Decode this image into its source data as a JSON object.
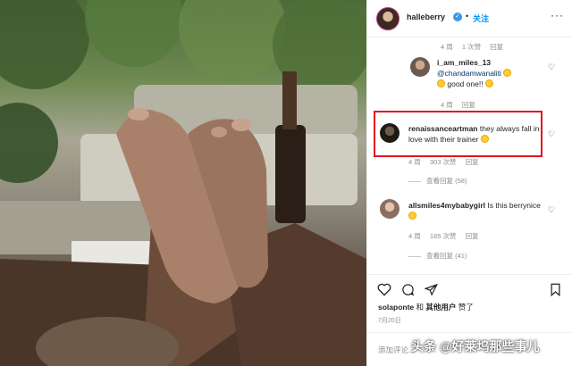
{
  "post": {
    "photo_alt": ""
  },
  "header": {
    "username": "halleberry",
    "verified_mark": "✓",
    "separator": "•",
    "follow_label": "关注",
    "more_label": "···"
  },
  "comments": [
    {
      "meta": {
        "age": "4 周",
        "likes": "1 次赞",
        "reply": "回复"
      }
    },
    {
      "username": "i_am_miles_13",
      "mention": "@chandamwanaliti",
      "text": "good one!!",
      "meta": {
        "age": "4 周",
        "reply": "回复"
      }
    },
    {
      "username": "renaissanceartman",
      "text": "they always fall in love with their trainer",
      "meta": {
        "age": "4 周",
        "likes": "303 次赞",
        "reply": "回复"
      },
      "view_replies": "查看回复 (58)"
    },
    {
      "username": "allsmiles4mybabygirl",
      "text": "Is this berrynice",
      "meta": {
        "age": "4 周",
        "likes": "185 次赞",
        "reply": "回复"
      },
      "view_replies": "查看回复 (41)"
    }
  ],
  "likes_line": {
    "user": "solaponte",
    "middle": " 和 ",
    "others": "其他用户",
    "suffix": " 赞了"
  },
  "date": "7月20日",
  "add_comment_placeholder": "添加评论...",
  "watermark": "头条 @好莱坞那些事儿",
  "colors": {
    "accent": "#0095f6",
    "highlight_box": "#e0141e",
    "muted": "#8e8e8e"
  },
  "icons": [
    "verified-icon",
    "more-icon",
    "heart-icon",
    "comment-icon",
    "share-icon",
    "bookmark-icon"
  ]
}
